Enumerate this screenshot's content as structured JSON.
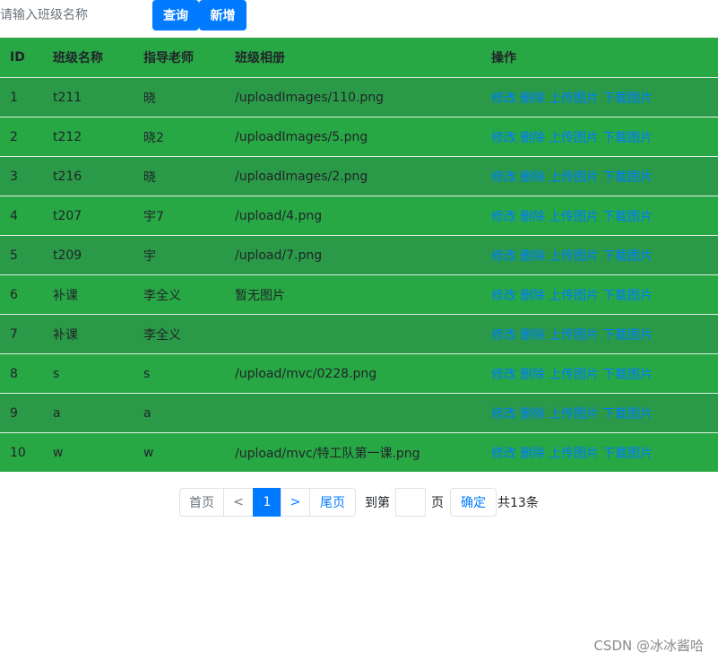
{
  "search": {
    "placeholder": "请输入班级名称",
    "value": ""
  },
  "toolbar": {
    "query_label": "查询",
    "add_label": "新增"
  },
  "table": {
    "headers": {
      "id": "ID",
      "name": "班级名称",
      "teacher": "指导老师",
      "album": "班级相册",
      "ops": "操作"
    },
    "actions": [
      "修改",
      "删除",
      "上传图片",
      "下载图片"
    ],
    "rows": [
      {
        "id": "1",
        "name": "t211",
        "teacher": "晓",
        "album": "/uploadImages/110.png"
      },
      {
        "id": "2",
        "name": "t212",
        "teacher": "晓2",
        "album": "/uploadImages/5.png"
      },
      {
        "id": "3",
        "name": "t216",
        "teacher": "晓",
        "album": "/uploadImages/2.png"
      },
      {
        "id": "4",
        "name": "t207",
        "teacher": "宇7",
        "album": "/upload/4.png"
      },
      {
        "id": "5",
        "name": "t209",
        "teacher": "宇",
        "album": "/upload/7.png"
      },
      {
        "id": "6",
        "name": "补课",
        "teacher": "李全义",
        "album": "暂无图片"
      },
      {
        "id": "7",
        "name": "补课",
        "teacher": "李全义",
        "album": ""
      },
      {
        "id": "8",
        "name": "s",
        "teacher": "s",
        "album": "/upload/mvc/0228.png"
      },
      {
        "id": "9",
        "name": "a",
        "teacher": "a",
        "album": ""
      },
      {
        "id": "10",
        "name": "w",
        "teacher": "w",
        "album": "/upload/mvc/特工队第一课.png"
      }
    ]
  },
  "pagination": {
    "first": "首页",
    "prev": "<",
    "current": "1",
    "next": ">",
    "last": "尾页",
    "goto_prefix": "到第",
    "goto_value": "",
    "goto_suffix": "页",
    "confirm": "确定",
    "total": "共13条"
  },
  "watermark": "CSDN @冰冰酱哈",
  "colors": {
    "table_bg": "#28a745",
    "accent": "#007bff"
  }
}
